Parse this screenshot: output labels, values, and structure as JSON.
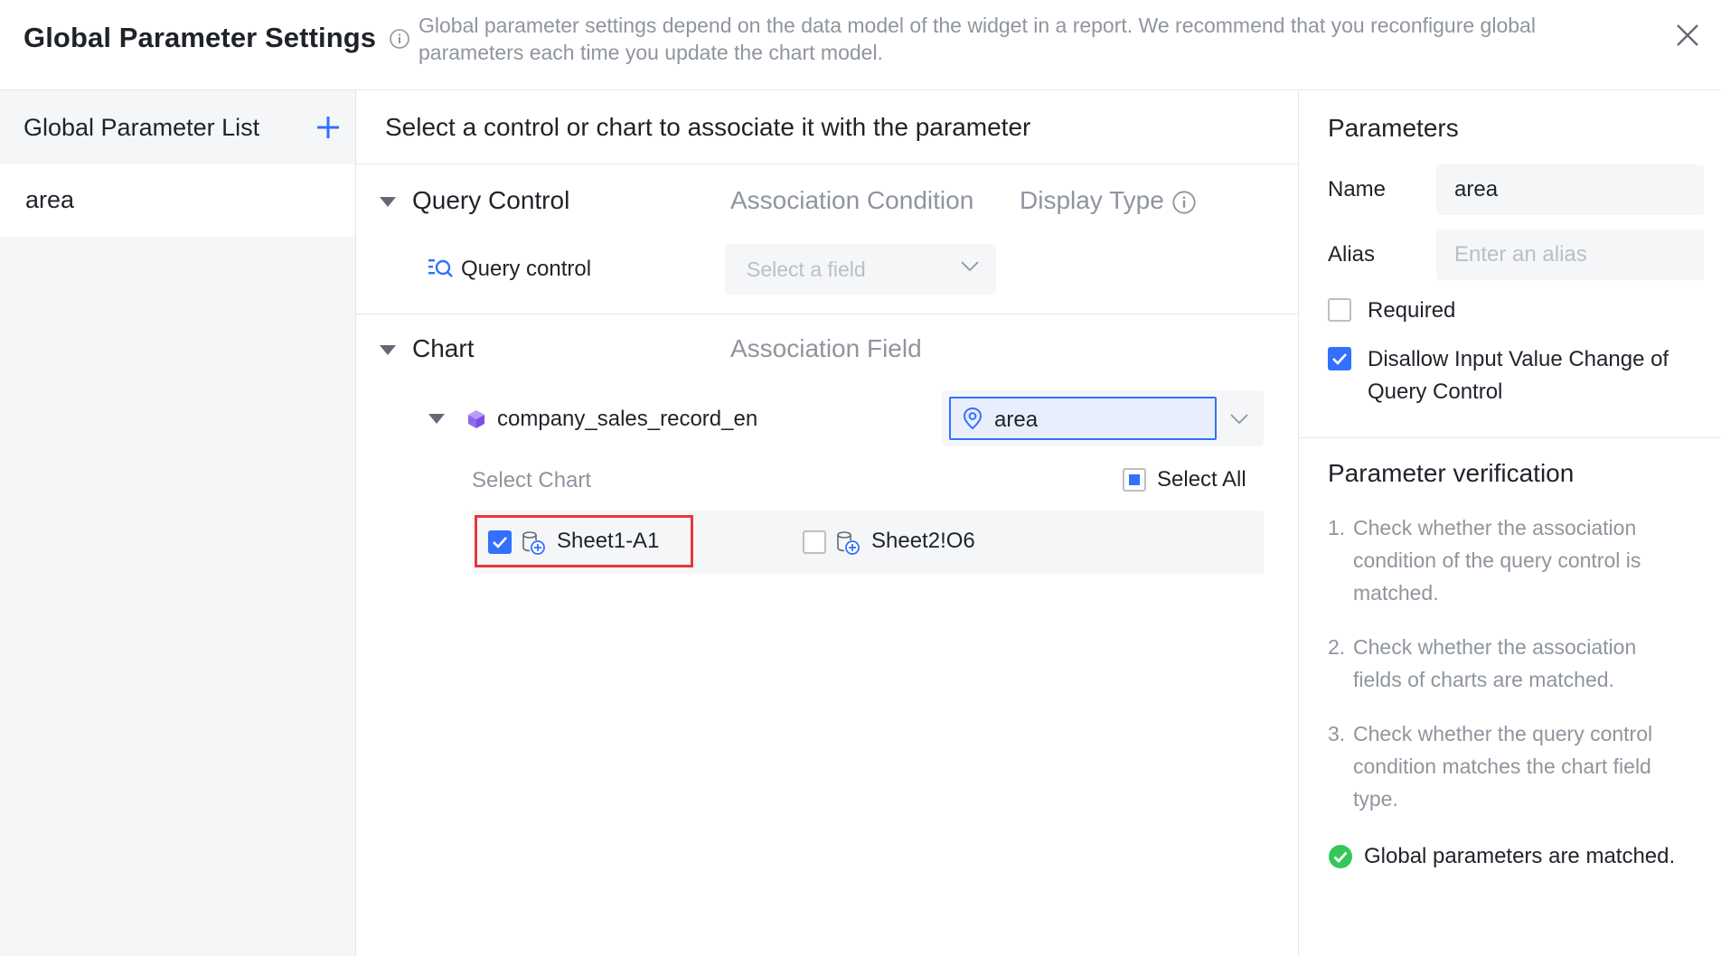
{
  "header": {
    "title": "Global Parameter Settings",
    "description": "Global parameter settings depend on the data model of the widget in a report. We recommend that you reconfigure global parameters each time you update the chart model."
  },
  "left_panel": {
    "title": "Global Parameter List",
    "items": [
      {
        "label": "area",
        "selected": true
      }
    ]
  },
  "middle_panel": {
    "instruction": "Select a control or chart to associate it with the parameter",
    "query_control": {
      "section_title": "Query Control",
      "col_association_condition": "Association Condition",
      "col_display_type": "Display Type",
      "row_label": "Query control",
      "field_placeholder": "Select a field"
    },
    "chart": {
      "section_title": "Chart",
      "col_association_field": "Association Field",
      "dataset_name": "company_sales_record_en",
      "association_field_value": "area",
      "select_chart_label": "Select Chart",
      "select_all_label": "Select All",
      "charts": [
        {
          "label": "Sheet1-A1",
          "checked": true
        },
        {
          "label": "Sheet2!O6",
          "checked": false
        }
      ]
    }
  },
  "right_panel": {
    "title": "Parameters",
    "name_label": "Name",
    "name_value": "area",
    "alias_label": "Alias",
    "alias_placeholder": "Enter an alias",
    "required_label": "Required",
    "required_checked": false,
    "disallow_label_line1": "Disallow Input Value Change of",
    "disallow_label_line2": "Query Control",
    "disallow_checked": true,
    "verification": {
      "title": "Parameter verification",
      "items": [
        {
          "num": "1.",
          "text": "Check whether the association condition of the query control is matched."
        },
        {
          "num": "2.",
          "text": "Check whether the association fields of charts are matched."
        },
        {
          "num": "3.",
          "text": "Check whether the query control condition matches the chart field type."
        }
      ],
      "status": "Global parameters are matched."
    }
  },
  "colors": {
    "accent": "#3370ff",
    "success": "#34c759",
    "highlight": "#e53935",
    "muted_text": "#8f959e"
  }
}
